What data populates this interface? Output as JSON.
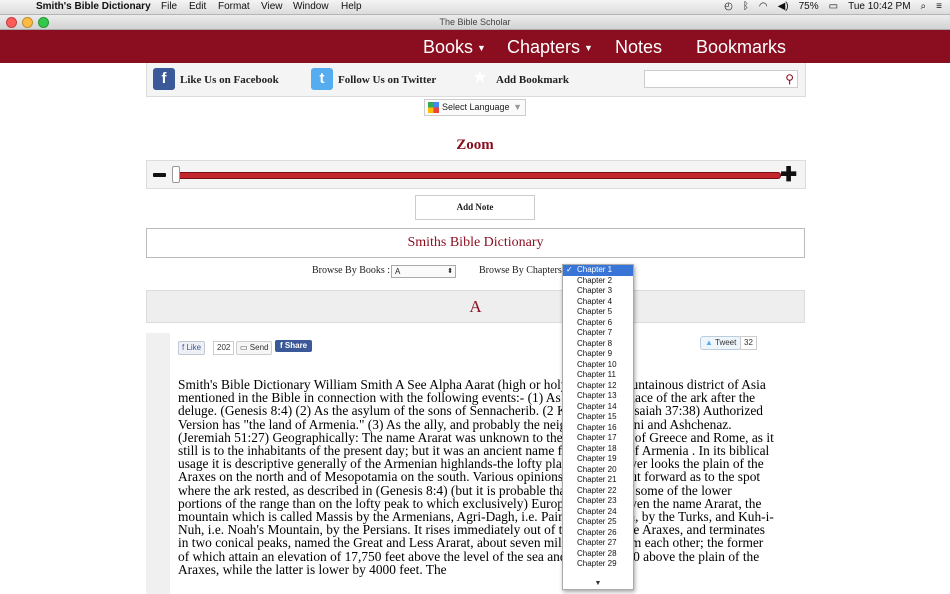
{
  "menubar": {
    "app": "Smith's Bible Dictionary",
    "items": [
      "File",
      "Edit",
      "Format",
      "View",
      "Window",
      "Help"
    ],
    "battery": "75%",
    "clock": "Tue 10:42 PM"
  },
  "window": {
    "title": "The Bible Scholar"
  },
  "nav": {
    "books": "Books",
    "chapters": "Chapters",
    "notes": "Notes",
    "bookmarks": "Bookmarks"
  },
  "social": {
    "facebook": "Like Us on Facebook",
    "twitter": "Follow Us on Twitter",
    "bookmark": "Add Bookmark",
    "search_value": ""
  },
  "language": {
    "label": "Select Language"
  },
  "zoom": {
    "title": "Zoom",
    "level": 0.0
  },
  "add_note": "Add Note",
  "dictionary_title": "Smiths Bible Dictionary",
  "browse": {
    "books_label": "Browse By Books :",
    "books_value": "A",
    "chapters_label": "Browse By Chapters"
  },
  "letter": "A",
  "share_bar": {
    "like": "Like",
    "like_count": "202",
    "send": "Send",
    "share": "Share",
    "tweet": "Tweet",
    "tweet_count": "32"
  },
  "entry_text": "Smith's Bible Dictionary William Smith A See Alpha Aarat (high or holy land), a mountainous district of Asia mentioned in the Bible in connection with the following events:- (1) As the resting-place of the ark after the deluge. (Genesis 8:4) (2) As the asylum of the sons of Sennacherib. (2 Kings 19:37; Isaiah 37:38) Authorized Version has \"the land of Armenia.\" (3) As the ally, and probably the neighbor, of Minni and Ashchenaz. (Jeremiah 51:27) Geographically: The name Ararat was unknown to the geographers of Greece and Rome, as it still is to the inhabitants of the present day; but it was an ancient name for a portion of Armenia . In its biblical usage it is descriptive generally of the Armenian highlands-the lofty plateau which over looks the plain of the Araxes on the north and of Mesopotamia on the south. Various opinions have been put forward as to the spot where the ark rested, as described in (Genesis 8:4) (but it is probable that it rested on some of the lower portions of the range than on the lofty peak to which exclusively) Europeans have given the name Ararat, the mountain which is called Massis by the Armenians, Agri-Dagh, i.e. Painful Mountain, by the Turks, and Kuh-i-Nuh, i.e. Noah's Mountain, by the Persians. It rises immediately out of the plain of the Araxes, and terminates in two conical peaks, named the Great and Less Ararat, about seven miles distant from each other; the former of which attain an elevation of 17,750 feet above the level of the sea and about 14,000 above the plain of the Araxes, while the latter is lower by 4000 feet. The",
  "chapters": [
    "Chapter 1",
    "Chapter 2",
    "Chapter 3",
    "Chapter 4",
    "Chapter 5",
    "Chapter 6",
    "Chapter 7",
    "Chapter 8",
    "Chapter 9",
    "Chapter 10",
    "Chapter 11",
    "Chapter 12",
    "Chapter 13",
    "Chapter 14",
    "Chapter 15",
    "Chapter 16",
    "Chapter 17",
    "Chapter 18",
    "Chapter 19",
    "Chapter 20",
    "Chapter 21",
    "Chapter 22",
    "Chapter 23",
    "Chapter 24",
    "Chapter 25",
    "Chapter 26",
    "Chapter 27",
    "Chapter 28",
    "Chapter 29"
  ],
  "selected_chapter": "Chapter 1"
}
